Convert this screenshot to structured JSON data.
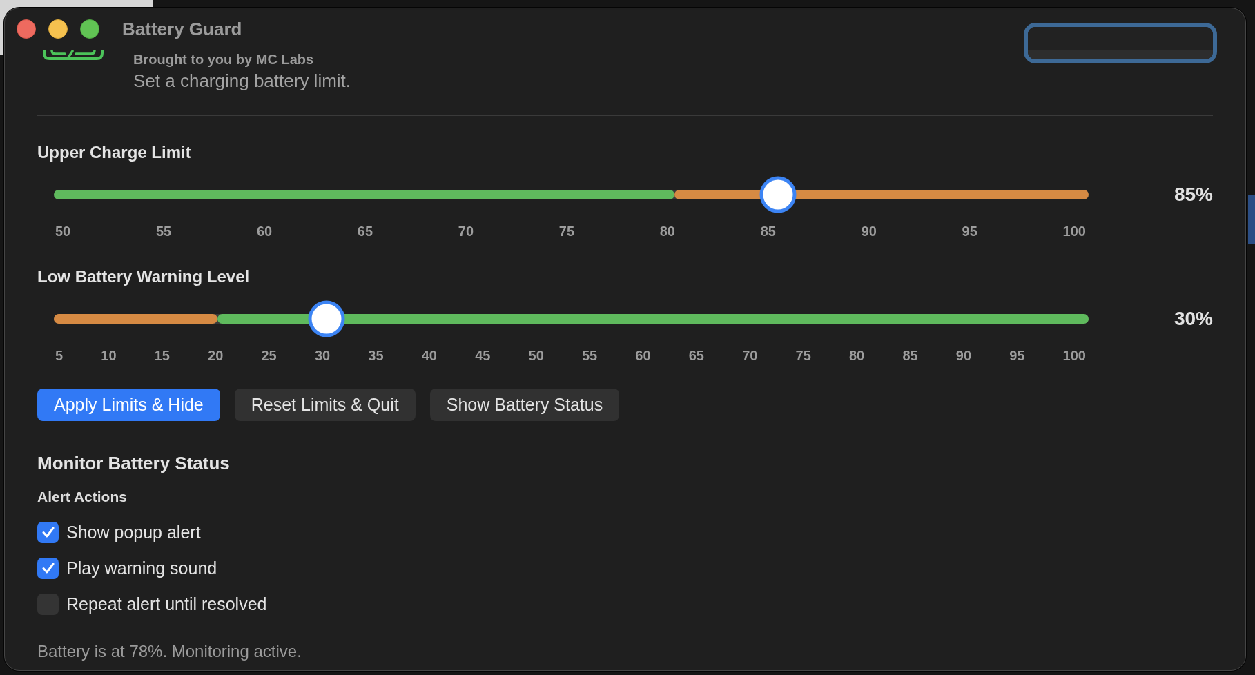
{
  "window": {
    "title": "Battery Guard"
  },
  "header": {
    "byline": "Brought to you by MC Labs",
    "subtitle": "Set a charging battery limit."
  },
  "sliders": [
    {
      "label": "Upper Charge Limit",
      "level": 0.7,
      "reading": "85%",
      "zones": [
        {
          "color": "#5fba5d",
          "level": 0.6
        },
        {
          "color": "#d68a43",
          "level": 0.4
        }
      ],
      "ticks": [
        "50",
        "55",
        "60",
        "65",
        "70",
        "75",
        "80",
        "85",
        "90",
        "95",
        "100"
      ]
    },
    {
      "label": "Low Battery Warning Level",
      "level": 0.2632,
      "reading": "30%",
      "zones": [
        {
          "color": "#d68a43",
          "level": 0.1579
        },
        {
          "color": "#5fba5d",
          "level": 0.8421
        }
      ],
      "ticks": [
        "5",
        "10",
        "15",
        "20",
        "25",
        "30",
        "35",
        "40",
        "45",
        "50",
        "55",
        "60",
        "65",
        "70",
        "75",
        "80",
        "85",
        "90",
        "95",
        "100"
      ]
    }
  ],
  "buttons": [
    {
      "label": "Apply Limits & Hide",
      "kind": "primary"
    },
    {
      "label": "Reset Limits & Quit",
      "kind": "secondary"
    },
    {
      "label": "Show Battery Status",
      "kind": "secondary"
    }
  ],
  "monitor": {
    "title": "Monitor Battery Status",
    "subtitle": "Alert Actions",
    "options": [
      {
        "label": "Show popup alert",
        "checked": true
      },
      {
        "label": "Play warning sound",
        "checked": true
      },
      {
        "label": "Repeat alert until resolved",
        "checked": false
      }
    ]
  },
  "status_bar": "Battery is at 78%. Monitoring active."
}
